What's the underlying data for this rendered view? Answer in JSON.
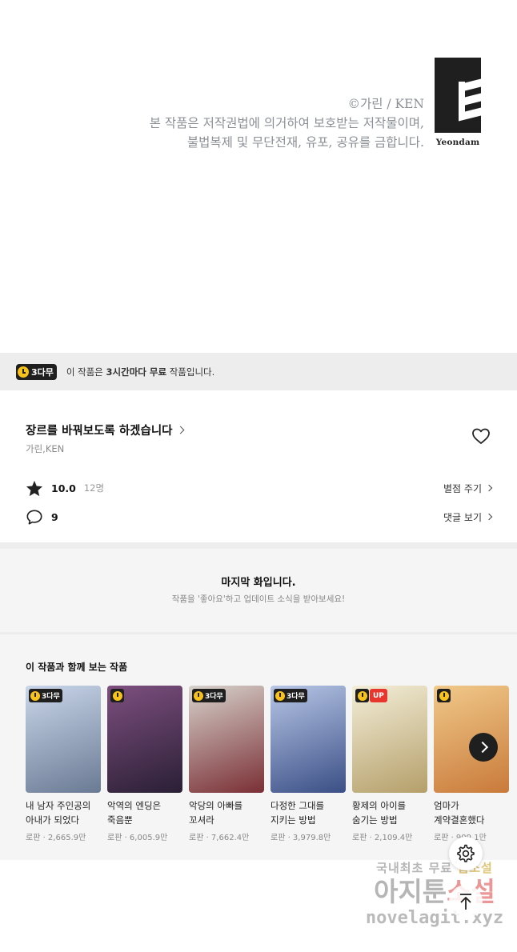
{
  "copyright": {
    "line1": "©가린 / KEN",
    "line2": "본 작품은 저작권법에 의거하여 보호받는 저작물이며,",
    "line3": "불법복제 및 무단전재, 유포, 공유를 금합니다.",
    "logo_text": "Yeondam"
  },
  "free_notice": {
    "badge": "3다무",
    "text_pre": "이 작품은 ",
    "text_bold": "3시간마다 무료",
    "text_post": " 작품입니다."
  },
  "work": {
    "title": "장르를 바꿔보도록 하겠습니다",
    "authors": "가린,KEN",
    "rating": "10.0",
    "rating_count": "12명",
    "rate_link": "별점 주기",
    "comments": "9",
    "comment_link": "댓글 보기"
  },
  "last_episode": {
    "title": "마지막 화입니다.",
    "subtitle": "작품을 '좋아요'하고 업데이트 소식을 받아보세요!"
  },
  "recommendations": {
    "title": "이 작품과 함께 보는 작품",
    "items": [
      {
        "name": "내 남자 주인공의 아내가 되었다",
        "meta": "로판 · 2,665.9만",
        "badge": "3다무",
        "up": "",
        "color_a": "#c9d6ea",
        "color_b": "#6b7a94"
      },
      {
        "name": "악역의 엔딩은 죽음뿐",
        "meta": "로판 · 6,005.9만",
        "badge": "",
        "up": "",
        "color_a": "#7d4f7f",
        "color_b": "#2a1f35"
      },
      {
        "name": "악당의 아빠를 꼬셔라",
        "meta": "로판 · 7,662.4만",
        "badge": "3다무",
        "up": "",
        "color_a": "#d7d2cc",
        "color_b": "#7a2f35"
      },
      {
        "name": "다정한 그대를 지키는 방법",
        "meta": "로판 · 3,979.8만",
        "badge": "3다무",
        "up": "",
        "color_a": "#b7c6e6",
        "color_b": "#3b4f86"
      },
      {
        "name": "황제의 아이를 숨기는 방법",
        "meta": "로판 · 2,109.4만",
        "badge": "",
        "up": "UP",
        "color_a": "#f3eed8",
        "color_b": "#b59f6a"
      },
      {
        "name": "엄마가 계약결혼했다",
        "meta": "로판 · 909.1만",
        "badge": "",
        "up": "",
        "color_a": "#f0c98a",
        "color_b": "#c97a3a"
      }
    ]
  },
  "watermark": {
    "line1_a": "국내최초 무료 ",
    "line1_b": "웹소설",
    "line2_a": "아지툰",
    "line2_b": "소설",
    "line3": "novelagit.xyz"
  },
  "colors": {
    "accent_yellow": "#f7c21b",
    "badge_dark": "#1f1f1f",
    "up_red": "#e8362f",
    "bar_gray": "#ededed"
  },
  "icons": [
    "clock-icon",
    "chevron-right-icon",
    "heart-icon",
    "star-icon",
    "comment-icon",
    "settings-icon",
    "arrow-up-icon"
  ]
}
